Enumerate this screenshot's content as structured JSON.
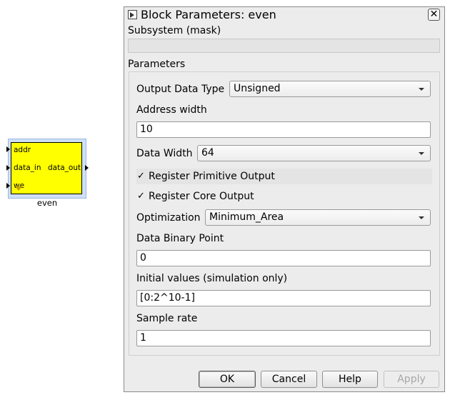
{
  "block": {
    "name": "even",
    "ports": {
      "addr": "addr",
      "data_in": "data_in",
      "we": "we",
      "data_out": "data_out"
    }
  },
  "dialog": {
    "title": "Block Parameters: even",
    "subsystem_label": "Subsystem (mask)",
    "parameters_label": "Parameters",
    "output_data_type": {
      "label": "Output Data Type",
      "value": "Unsigned"
    },
    "address_width": {
      "label": "Address width",
      "value": "10"
    },
    "data_width": {
      "label": "Data Width",
      "value": "64"
    },
    "register_primitive_output": {
      "label": "Register Primitive Output",
      "checked": true,
      "mark": "✓"
    },
    "register_core_output": {
      "label": "Register Core Output",
      "checked": true,
      "mark": "✓"
    },
    "optimization": {
      "label": "Optimization",
      "value": "Minimum_Area"
    },
    "data_binary_point": {
      "label": "Data Binary Point",
      "value": "0"
    },
    "initial_values": {
      "label": "Initial values (simulation only)",
      "value": "[0:2^10-1]"
    },
    "sample_rate": {
      "label": "Sample rate",
      "value": "1"
    },
    "buttons": {
      "ok": "OK",
      "cancel": "Cancel",
      "help": "Help",
      "apply": "Apply"
    },
    "close_glyph": "✕"
  }
}
